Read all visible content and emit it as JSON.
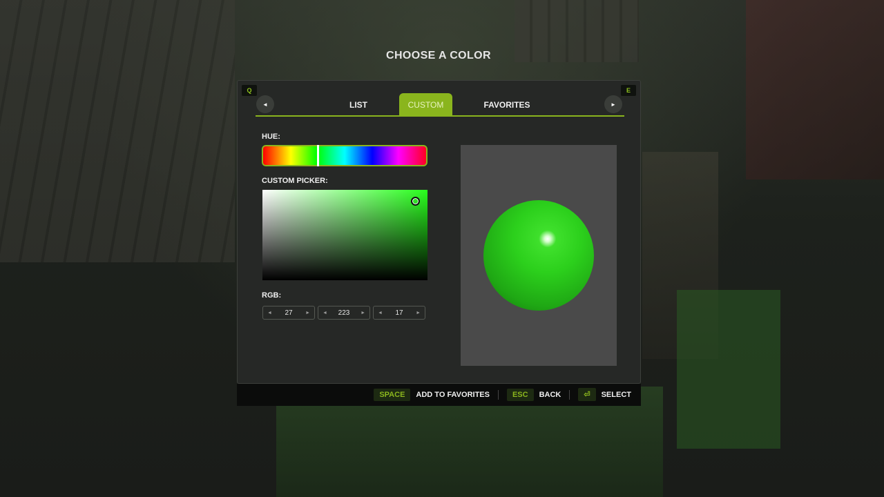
{
  "header": {
    "title": "CHOOSE A COLOR"
  },
  "shortcuts": {
    "prev": "Q",
    "next": "E"
  },
  "nav": {
    "prev_icon": "◄",
    "next_icon": "►"
  },
  "tabs": [
    {
      "label": "LIST",
      "active": false
    },
    {
      "label": "CUSTOM",
      "active": true
    },
    {
      "label": "FAVORITES",
      "active": false
    }
  ],
  "hue": {
    "label": "HUE:",
    "value_fraction": 0.33
  },
  "picker": {
    "label": "CUSTOM PICKER:"
  },
  "rgb": {
    "label": "RGB:",
    "r": "27",
    "g": "223",
    "b": "17",
    "arrow_left": "◄",
    "arrow_right": "►"
  },
  "colors": {
    "accent": "#8ab51d",
    "selected": "#1bdf11",
    "panel": "#262826"
  },
  "footer": {
    "favorites_key": "SPACE",
    "favorites_label": "ADD TO FAVORITES",
    "back_key": "ESC",
    "back_label": "BACK",
    "select_key": "⏎",
    "select_label": "SELECT"
  }
}
